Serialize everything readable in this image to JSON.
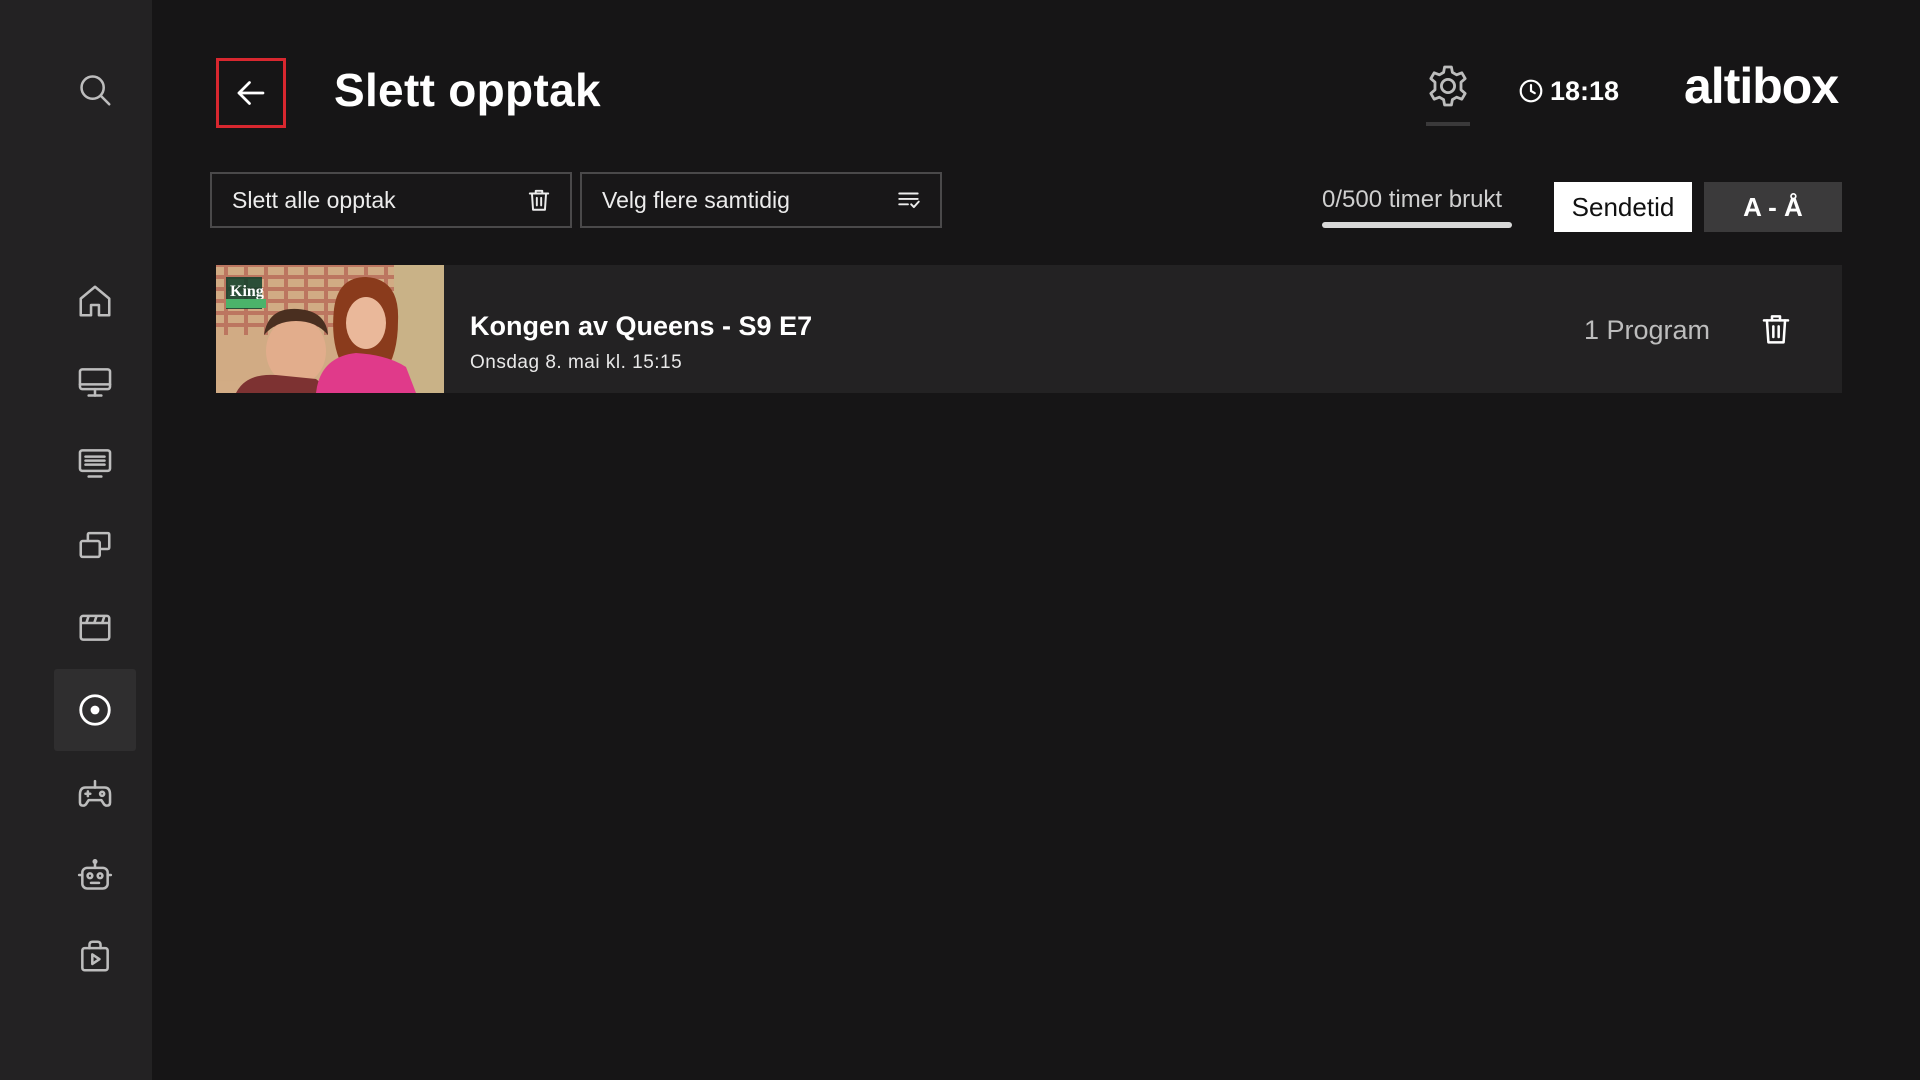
{
  "header": {
    "title": "Slett opptak",
    "time": "18:18",
    "logo": "altibox"
  },
  "sidebar": {
    "items": [
      {
        "icon": "search-icon"
      },
      {
        "icon": "home-icon"
      },
      {
        "icon": "tv-icon"
      },
      {
        "icon": "tv-guide-icon"
      },
      {
        "icon": "stacked-screens-icon"
      },
      {
        "icon": "clapperboard-icon"
      },
      {
        "icon": "record-icon",
        "active": true
      },
      {
        "icon": "gamepad-icon"
      },
      {
        "icon": "robot-icon"
      },
      {
        "icon": "store-bag-icon"
      }
    ]
  },
  "toolbar": {
    "delete_all_label": "Slett alle opptak",
    "select_multiple_label": "Velg flere samtidig",
    "usage_text": "0/500 timer brukt",
    "usage_fraction": 0,
    "sort_options": [
      "Sendetid",
      "A - Å"
    ],
    "sort_selected": "Sendetid"
  },
  "recordings": [
    {
      "title": "Kongen av Queens - S9 E7",
      "subtitle": "Onsdag 8. mai kl. 15:15",
      "count_label": "1 Program",
      "thumb_logo": "King"
    }
  ],
  "colors": {
    "background": "#161516",
    "sidebar": "#232223",
    "accent_red": "#d8272f"
  }
}
